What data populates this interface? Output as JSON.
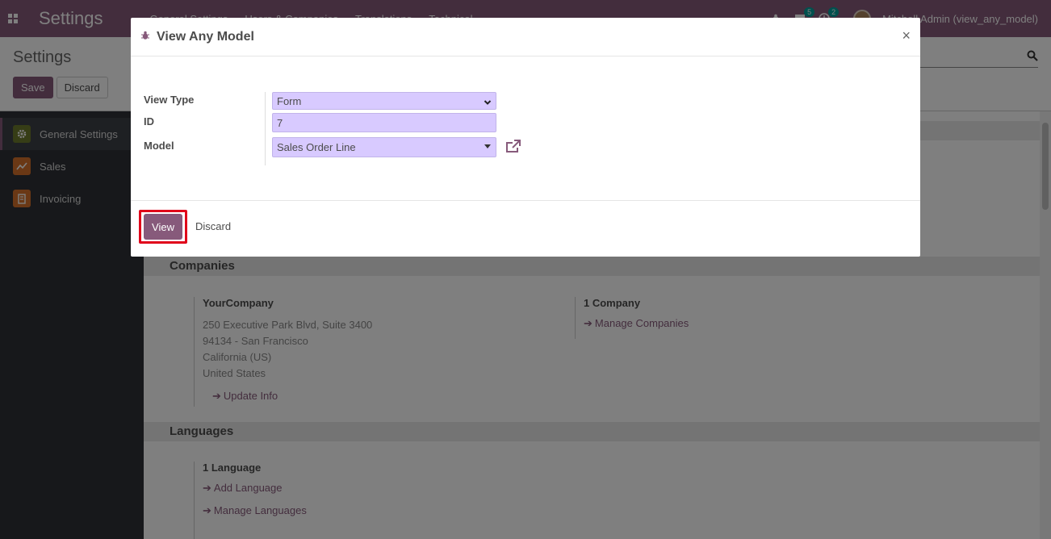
{
  "navbar": {
    "app_title": "Settings",
    "menu": [
      "General Settings",
      "Users & Companies",
      "Translations",
      "Technical"
    ],
    "messages_count": "5",
    "activities_count": "2",
    "user": "Mitchell Admin (view_any_model)"
  },
  "control_panel": {
    "title": "Settings",
    "save_label": "Save",
    "discard_label": "Discard"
  },
  "sidebar": {
    "items": [
      {
        "label": "General Settings",
        "icon": "gear-icon",
        "active": true
      },
      {
        "label": "Sales",
        "icon": "chart-icon",
        "active": false
      },
      {
        "label": "Invoicing",
        "icon": "invoice-icon",
        "active": false
      }
    ]
  },
  "main": {
    "companies": {
      "heading": "Companies",
      "company_name": "YourCompany",
      "address": [
        "250 Executive Park Blvd, Suite 3400",
        "94134 - San Francisco",
        "California (US)",
        "United States"
      ],
      "update_info": "Update Info",
      "count_label": "1 Company",
      "manage_companies": "Manage Companies"
    },
    "languages": {
      "heading": "Languages",
      "count_label": "1 Language",
      "add_language": "Add Language",
      "manage_languages": "Manage Languages"
    }
  },
  "modal": {
    "title": "View Any Model",
    "close_symbol": "×",
    "fields": {
      "view_type_label": "View Type",
      "view_type_value": "Form",
      "id_label": "ID",
      "id_value": "7",
      "model_label": "Model",
      "model_value": "Sales Order Line"
    },
    "view_button": "View",
    "discard_button": "Discard"
  },
  "colors": {
    "brand": "#875a7b",
    "field_bg": "#d8caff",
    "highlight": "#e0001a"
  }
}
